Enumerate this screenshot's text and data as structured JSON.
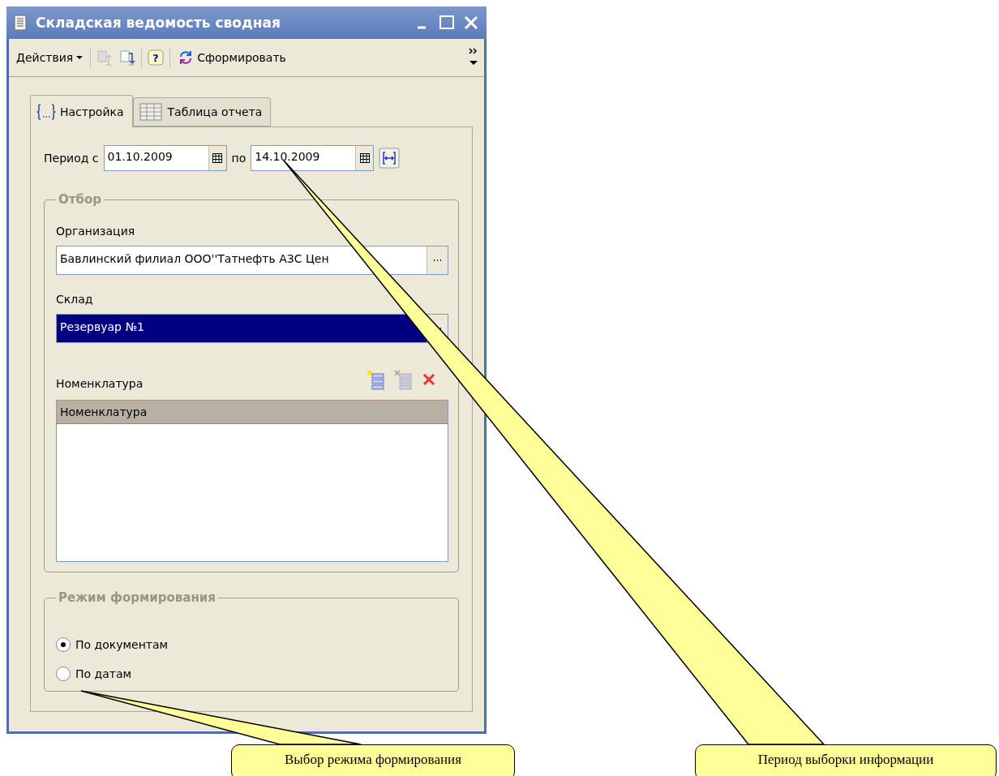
{
  "window": {
    "title": "Складская ведомость сводная"
  },
  "toolbar": {
    "actions_label": "Действия",
    "help": "?",
    "generate_label": "Сформировать"
  },
  "tabs": [
    {
      "label": "Настройка",
      "selected": true
    },
    {
      "label": "Таблица отчета",
      "selected": false
    }
  ],
  "period": {
    "label": "Период с",
    "from": "01.10.2009",
    "to_label": "по",
    "to": "14.10.2009"
  },
  "filter": {
    "title": "Отбор",
    "organization_label": "Организация",
    "organization": "Бавлинский филиал ООО''Татнефть АЗС Цен",
    "warehouse_label": "Склад",
    "warehouse": "Резервуар №1",
    "warehouse_selected": true,
    "nomenclature_label": "Номенклатура",
    "table": {
      "columns": [
        "Номенклатура"
      ]
    }
  },
  "mode": {
    "title": "Режим формирования",
    "options": [
      {
        "label": "По документам",
        "selected": true
      },
      {
        "label": "По датам",
        "selected": false
      }
    ]
  },
  "callouts": [
    {
      "text": "Выбор режима формирования"
    },
    {
      "text": "Период выборки информации"
    }
  ]
}
